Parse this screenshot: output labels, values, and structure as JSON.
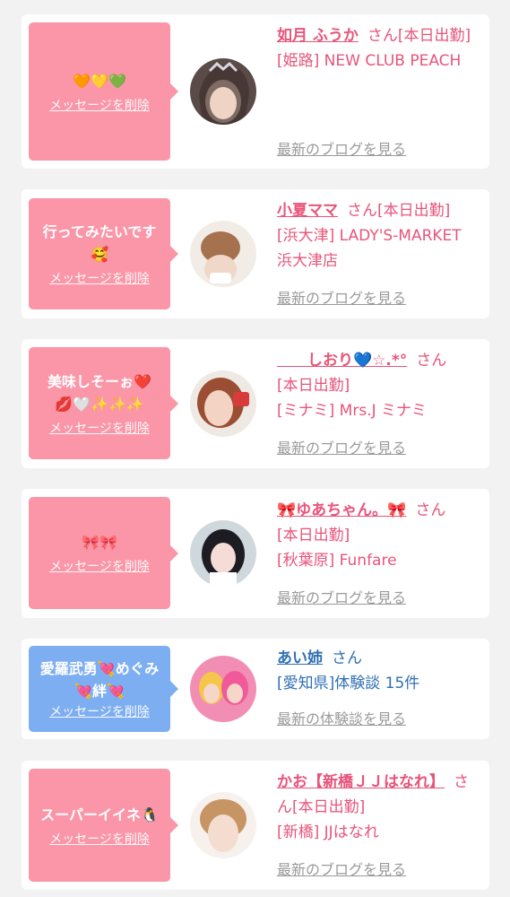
{
  "delete_label": "メッセージを削除",
  "blog_link_label": "最新のブログを見る",
  "review_link_label": "最新の体験談を見る",
  "honorific": "さん",
  "colors": {
    "pink_bubble": "#fa96a8",
    "blue_bubble": "#7eaef2",
    "pink_text": "#e8547a",
    "blue_text": "#2f6fb3",
    "link_gray": "#9a9a9a"
  },
  "items": [
    {
      "message": "🧡💛💚",
      "name": "如月 ふうか",
      "status": "[本日出勤]",
      "shop": "[姫路] NEW CLUB PEACH",
      "link": "最新のブログを見る"
    },
    {
      "message": "行ってみたいです🥰",
      "name": "小夏ママ",
      "status": "[本日出勤]",
      "shop": "[浜大津] LADY'S-MARKET 浜大津店",
      "link": "最新のブログを見る"
    },
    {
      "message": "美味しそーぉ❤️💋🤍✨✨✨",
      "name": "　　しおり💙☆.*°",
      "status": "[本日出勤]",
      "shop": "[ミナミ] Mrs.J ミナミ",
      "link": "最新のブログを見る"
    },
    {
      "message": "🎀🎀",
      "name": "🎀ゆあちゃん。🎀",
      "status": "[本日出勤]",
      "shop": "[秋葉原] Funfare",
      "link": "最新のブログを見る"
    },
    {
      "message": "愛羅武勇💘めぐみ💘絆💘",
      "name": "あい姉",
      "status": "",
      "shop": "[愛知県]体験談 15件",
      "link": "最新の体験談を見る"
    },
    {
      "message": "スーパーイイネ🐧",
      "name": "かお【新橋ＪＪはなれ】",
      "status": "[本日出勤]",
      "shop": "[新橋] JJはなれ",
      "link": "最新のブログを見る"
    }
  ]
}
